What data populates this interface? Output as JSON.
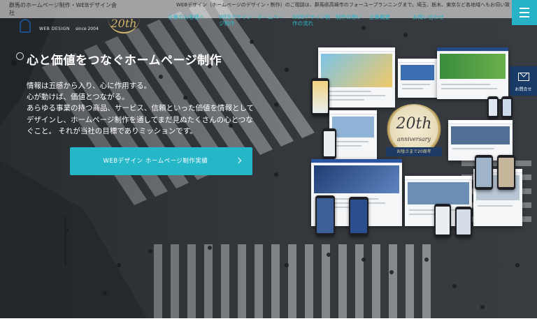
{
  "header": {
    "site_title": "群馬のホームページ制作・WEBデザイン会社",
    "top_note": "WEBデザイン（ホームページのデザイン・制作）のご相談は、群馬県高崎市のフォーユープランニングまで。埼玉、栃木、東京など各地域へもお伺い致します。",
    "logo": {
      "sub": "WEB DESIGN",
      "since": "since 2004",
      "badge": "20th"
    },
    "nav": [
      {
        "label": "企業のお客様へ"
      },
      {
        "label": "WEBデザイン・ホームページ制作"
      },
      {
        "label": "WEBデザイン制作の流れ"
      },
      {
        "label": "制作の想い"
      },
      {
        "label": "企業概要"
      },
      {
        "label": "お問い合わせ"
      }
    ],
    "menu_icon": "hamburger-icon"
  },
  "side_contact": {
    "label": "お問合せ",
    "icon": "mail-icon"
  },
  "hero": {
    "title": "心と価値をつなぐホームページ制作",
    "body": [
      "情報は五感から入り、心に作用する。",
      "心が動けば、価値とつながる。",
      "あらゆる事業の持つ商品、サービス、信頼といった価値を情報として",
      "デザインし、ホームページ制作を通してまだ見ぬたくさんの心とつな",
      "ぐこと。 それが当社の目標でありミッションです。"
    ],
    "cta_label": "WEBデザイン ホームページ制作実績",
    "cta_icon": "chevron-right-icon"
  },
  "anniversary": {
    "number": "20th",
    "word": "anniversary",
    "ribbon": "お陰さまで20周年"
  },
  "colors": {
    "accent": "#25b6c8",
    "nav_text": "#2fb7c8",
    "side_contact_bg": "#173b66",
    "gold": "#d2b46a"
  }
}
